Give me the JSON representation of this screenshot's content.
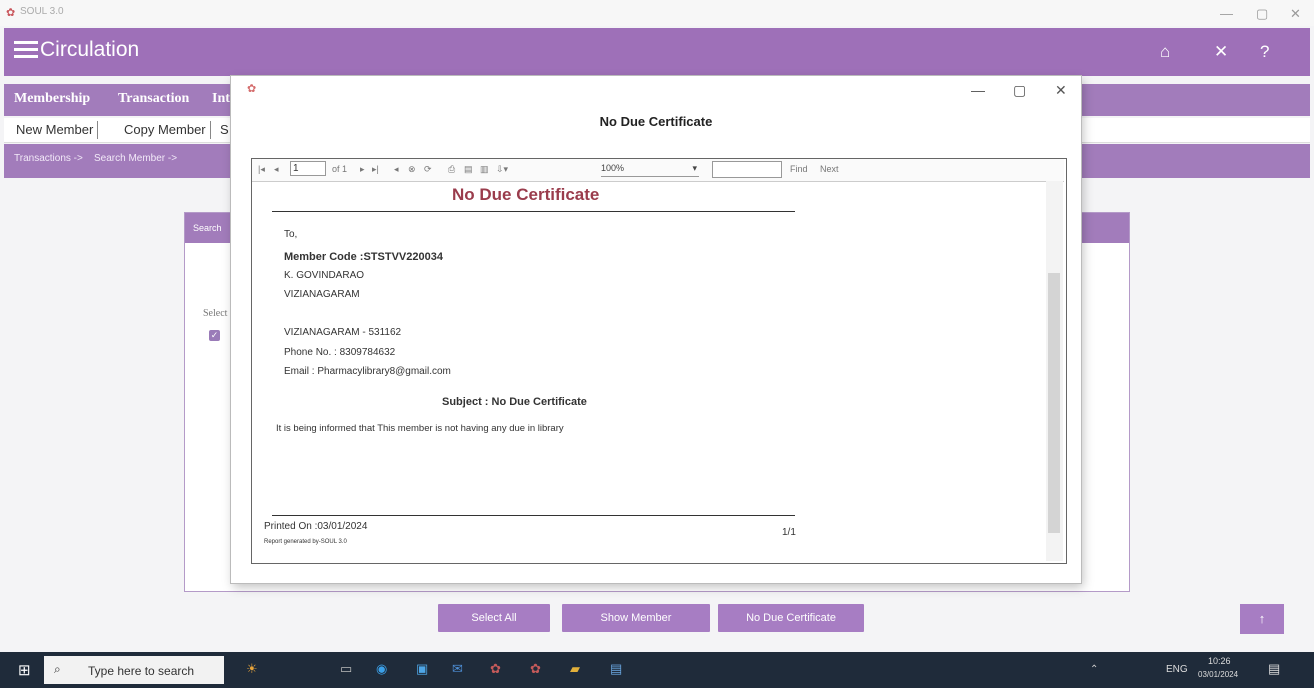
{
  "window": {
    "app_name": "SOUL 3.0"
  },
  "header": {
    "title": "Circulation"
  },
  "nav": {
    "membership": "Membership",
    "transaction": "Transaction",
    "int": "Int"
  },
  "subbar": {
    "new_member": "New Member",
    "copy_member": "Copy Member",
    "s": "S"
  },
  "breadcrumb": {
    "transactions": "Transactions ->",
    "search_member": "Search Member ->"
  },
  "panel": {
    "header": "Search",
    "select_label": "Select"
  },
  "buttons": {
    "select_all": "Select All",
    "show_member": "Show Member",
    "no_due_certificate": "No Due Certificate"
  },
  "dialog": {
    "title": "No Due Certificate",
    "toolbar": {
      "page_value": "1",
      "of_pages": "of 1",
      "zoom": "100%",
      "find": "Find",
      "next": "Next"
    },
    "report": {
      "title": "No Due Certificate",
      "to": "To,",
      "member_code": "Member Code :STSTVV220034",
      "name": "K. GOVINDARAO",
      "city": "VIZIANAGARAM",
      "pincode_line": "VIZIANAGARAM - 531162",
      "phone": "Phone No. : 8309784632",
      "email": "Email : Pharmacylibrary8@gmail.com",
      "subject": "Subject : No Due Certificate",
      "body": "It is being informed that This member is not having any due in library",
      "printed_on": "Printed On :03/01/2024",
      "page_count": "1/1",
      "generated_by": "Report generated by-SOUL 3.0"
    }
  },
  "taskbar": {
    "search_placeholder": "Type here to search",
    "lang": "ENG",
    "time": "10:26",
    "date": "03/01/2024"
  },
  "colors": {
    "accent": "#9e70b8",
    "button": "#a77dc3",
    "report_title": "#9a3c4c"
  }
}
